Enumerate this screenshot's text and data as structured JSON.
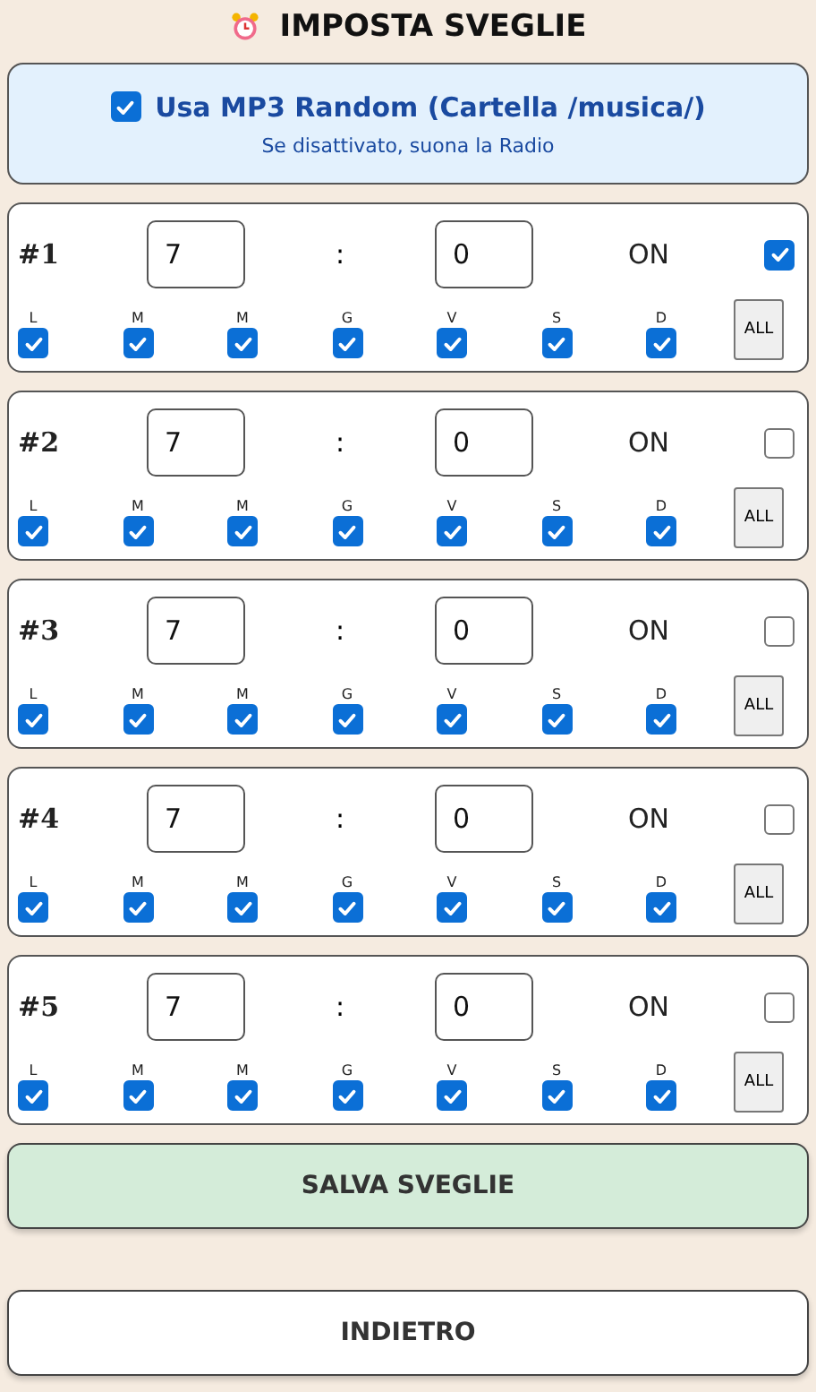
{
  "title": "IMPOSTA SVEGLIE",
  "mp3": {
    "label": "Usa MP3 Random (Cartella /musica/)",
    "checked": true,
    "note": "Se disattivato, suona la Radio"
  },
  "alarms": [
    {
      "label": "#1",
      "hour": "7",
      "separator": ":",
      "minute": "0",
      "status": "ON",
      "enabled": true,
      "days": [
        {
          "label": "L",
          "checked": true
        },
        {
          "label": "M",
          "checked": true
        },
        {
          "label": "M",
          "checked": true
        },
        {
          "label": "G",
          "checked": true
        },
        {
          "label": "V",
          "checked": true
        },
        {
          "label": "S",
          "checked": true
        },
        {
          "label": "D",
          "checked": true
        }
      ],
      "all_button": "ALL"
    },
    {
      "label": "#2",
      "hour": "7",
      "separator": ":",
      "minute": "0",
      "status": "ON",
      "enabled": false,
      "days": [
        {
          "label": "L",
          "checked": true
        },
        {
          "label": "M",
          "checked": true
        },
        {
          "label": "M",
          "checked": true
        },
        {
          "label": "G",
          "checked": true
        },
        {
          "label": "V",
          "checked": true
        },
        {
          "label": "S",
          "checked": true
        },
        {
          "label": "D",
          "checked": true
        }
      ],
      "all_button": "ALL"
    },
    {
      "label": "#3",
      "hour": "7",
      "separator": ":",
      "minute": "0",
      "status": "ON",
      "enabled": false,
      "days": [
        {
          "label": "L",
          "checked": true
        },
        {
          "label": "M",
          "checked": true
        },
        {
          "label": "M",
          "checked": true
        },
        {
          "label": "G",
          "checked": true
        },
        {
          "label": "V",
          "checked": true
        },
        {
          "label": "S",
          "checked": true
        },
        {
          "label": "D",
          "checked": true
        }
      ],
      "all_button": "ALL"
    },
    {
      "label": "#4",
      "hour": "7",
      "separator": ":",
      "minute": "0",
      "status": "ON",
      "enabled": false,
      "days": [
        {
          "label": "L",
          "checked": true
        },
        {
          "label": "M",
          "checked": true
        },
        {
          "label": "M",
          "checked": true
        },
        {
          "label": "G",
          "checked": true
        },
        {
          "label": "V",
          "checked": true
        },
        {
          "label": "S",
          "checked": true
        },
        {
          "label": "D",
          "checked": true
        }
      ],
      "all_button": "ALL"
    },
    {
      "label": "#5",
      "hour": "7",
      "separator": ":",
      "minute": "0",
      "status": "ON",
      "enabled": false,
      "days": [
        {
          "label": "L",
          "checked": true
        },
        {
          "label": "M",
          "checked": true
        },
        {
          "label": "M",
          "checked": true
        },
        {
          "label": "G",
          "checked": true
        },
        {
          "label": "V",
          "checked": true
        },
        {
          "label": "S",
          "checked": true
        },
        {
          "label": "D",
          "checked": true
        }
      ],
      "all_button": "ALL"
    }
  ],
  "buttons": [
    {
      "kind": "save",
      "label": "SALVA SVEGLIE"
    },
    {
      "kind": "back",
      "label": "INDIETRO"
    }
  ]
}
